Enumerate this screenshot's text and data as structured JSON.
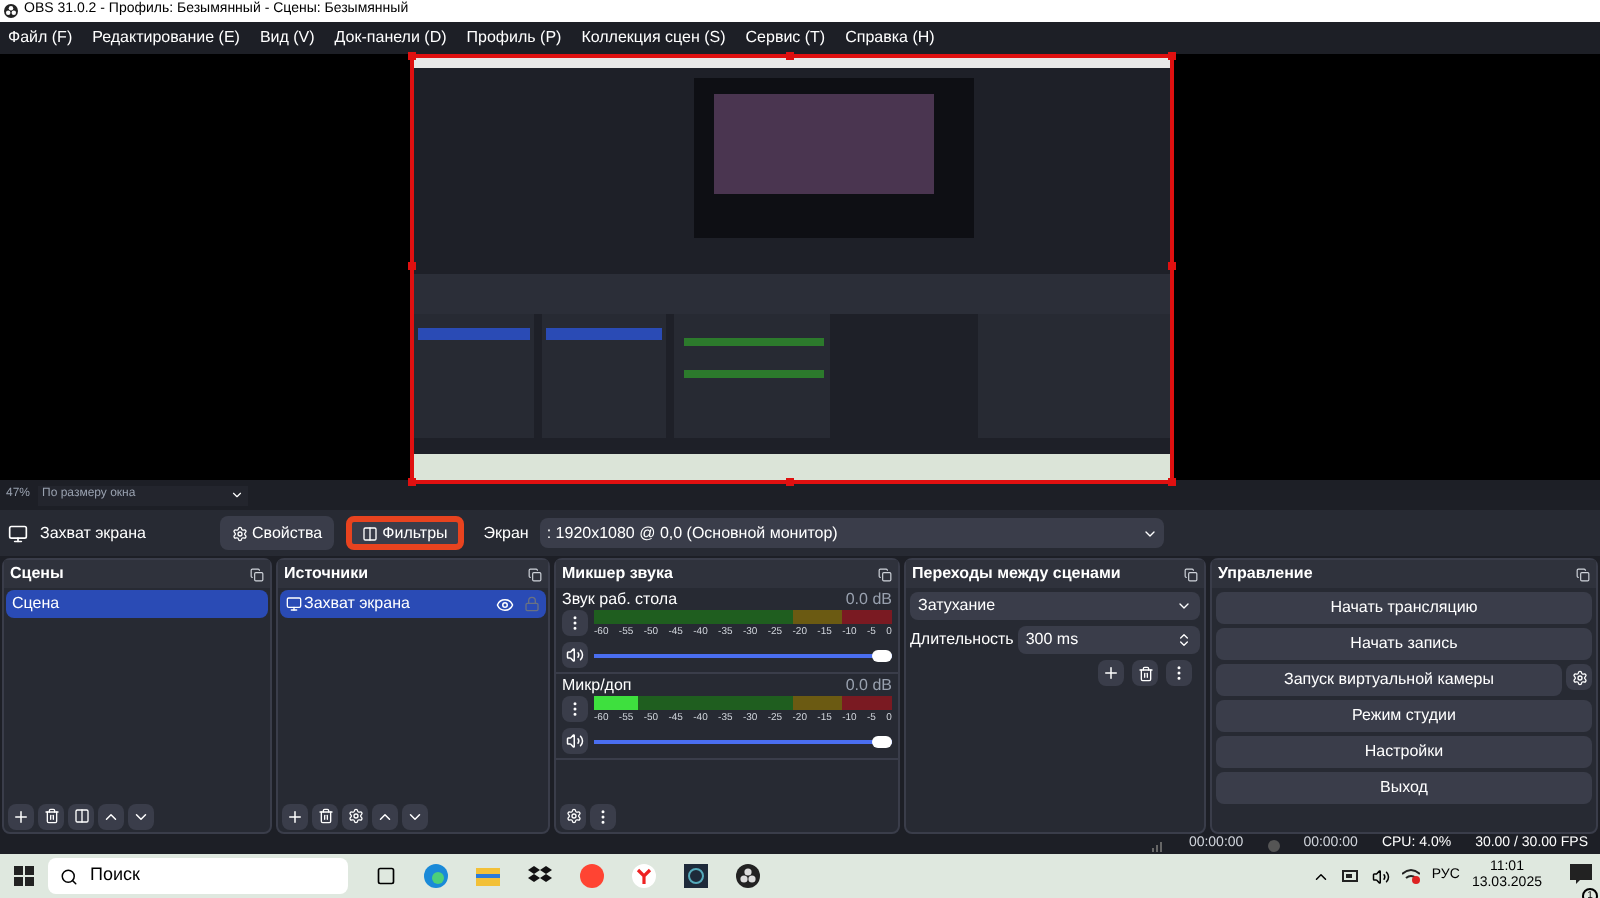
{
  "window": {
    "title": "OBS 31.0.2 - Профиль: Безымянный - Сцены: Безымянный"
  },
  "menu": [
    "Файл (F)",
    "Редактирование (E)",
    "Вид (V)",
    "Док-панели (D)",
    "Профиль (P)",
    "Коллекция сцен (S)",
    "Сервис (T)",
    "Справка (H)"
  ],
  "preview": {
    "kind": "picture",
    "selected": true
  },
  "preview_bar": {
    "zoom": "47%",
    "scale_mode": "По размеру окна"
  },
  "source_toolbar": {
    "source": "Захват экрана",
    "buttons": [
      {
        "kind": "properties",
        "label": "Свойства",
        "highlighted": false
      },
      {
        "kind": "filters",
        "label": "Фильтры",
        "highlighted": true
      }
    ],
    "field_label": "Экран",
    "field_value": ": 1920x1080 @ 0,0 (Основной монитор)"
  },
  "scenes": {
    "title": "Сцены",
    "items": [
      {
        "label": "Сцена",
        "selected": true
      }
    ]
  },
  "sources": {
    "title": "Источники",
    "items": [
      {
        "label": "Захват экрана",
        "selected": true,
        "visible": true,
        "locked": false
      }
    ]
  },
  "mixer": {
    "title": "Микшер звука",
    "channels": [
      {
        "name": "Звук раб. стола",
        "reading": "0.0 dB",
        "meter": {
          "level": 0
        },
        "scale": [
          "-60",
          "-55",
          "-50",
          "-45",
          "-40",
          "-35",
          "-30",
          "-25",
          "-20",
          "-15",
          "-10",
          "-5",
          "0"
        ],
        "volume": {
          "level": 1
        }
      },
      {
        "name": "Микр/доп",
        "reading": "0.0 dB",
        "meter": {
          "level": 0.15
        },
        "scale": [
          "-60",
          "-55",
          "-50",
          "-45",
          "-40",
          "-35",
          "-30",
          "-25",
          "-20",
          "-15",
          "-10",
          "-5",
          "0"
        ],
        "volume": {
          "level": 1
        }
      }
    ]
  },
  "transitions": {
    "title": "Переходы между сценами",
    "transition": "Затухание",
    "duration_label": "Длительность",
    "duration": "300 ms"
  },
  "controls": {
    "title": "Управление",
    "buttons": [
      {
        "label": "Начать трансляцию",
        "has_settings": false
      },
      {
        "label": "Начать запись",
        "has_settings": false
      },
      {
        "label": "Запуск виртуальной камеры",
        "has_settings": true
      },
      {
        "label": "Режим студии",
        "has_settings": false
      },
      {
        "label": "Настройки",
        "has_settings": false
      },
      {
        "label": "Выход",
        "has_settings": false
      }
    ]
  },
  "status": {
    "stream_time": "00:00:00",
    "record_time": "00:00:00",
    "cpu": "CPU: 4.0%",
    "fps": "30.00 / 30.00 FPS"
  },
  "taskbar": {
    "search": "Поиск",
    "language": "РУС",
    "time": "11:01",
    "date": "13.03.2025",
    "notifications": "1"
  }
}
